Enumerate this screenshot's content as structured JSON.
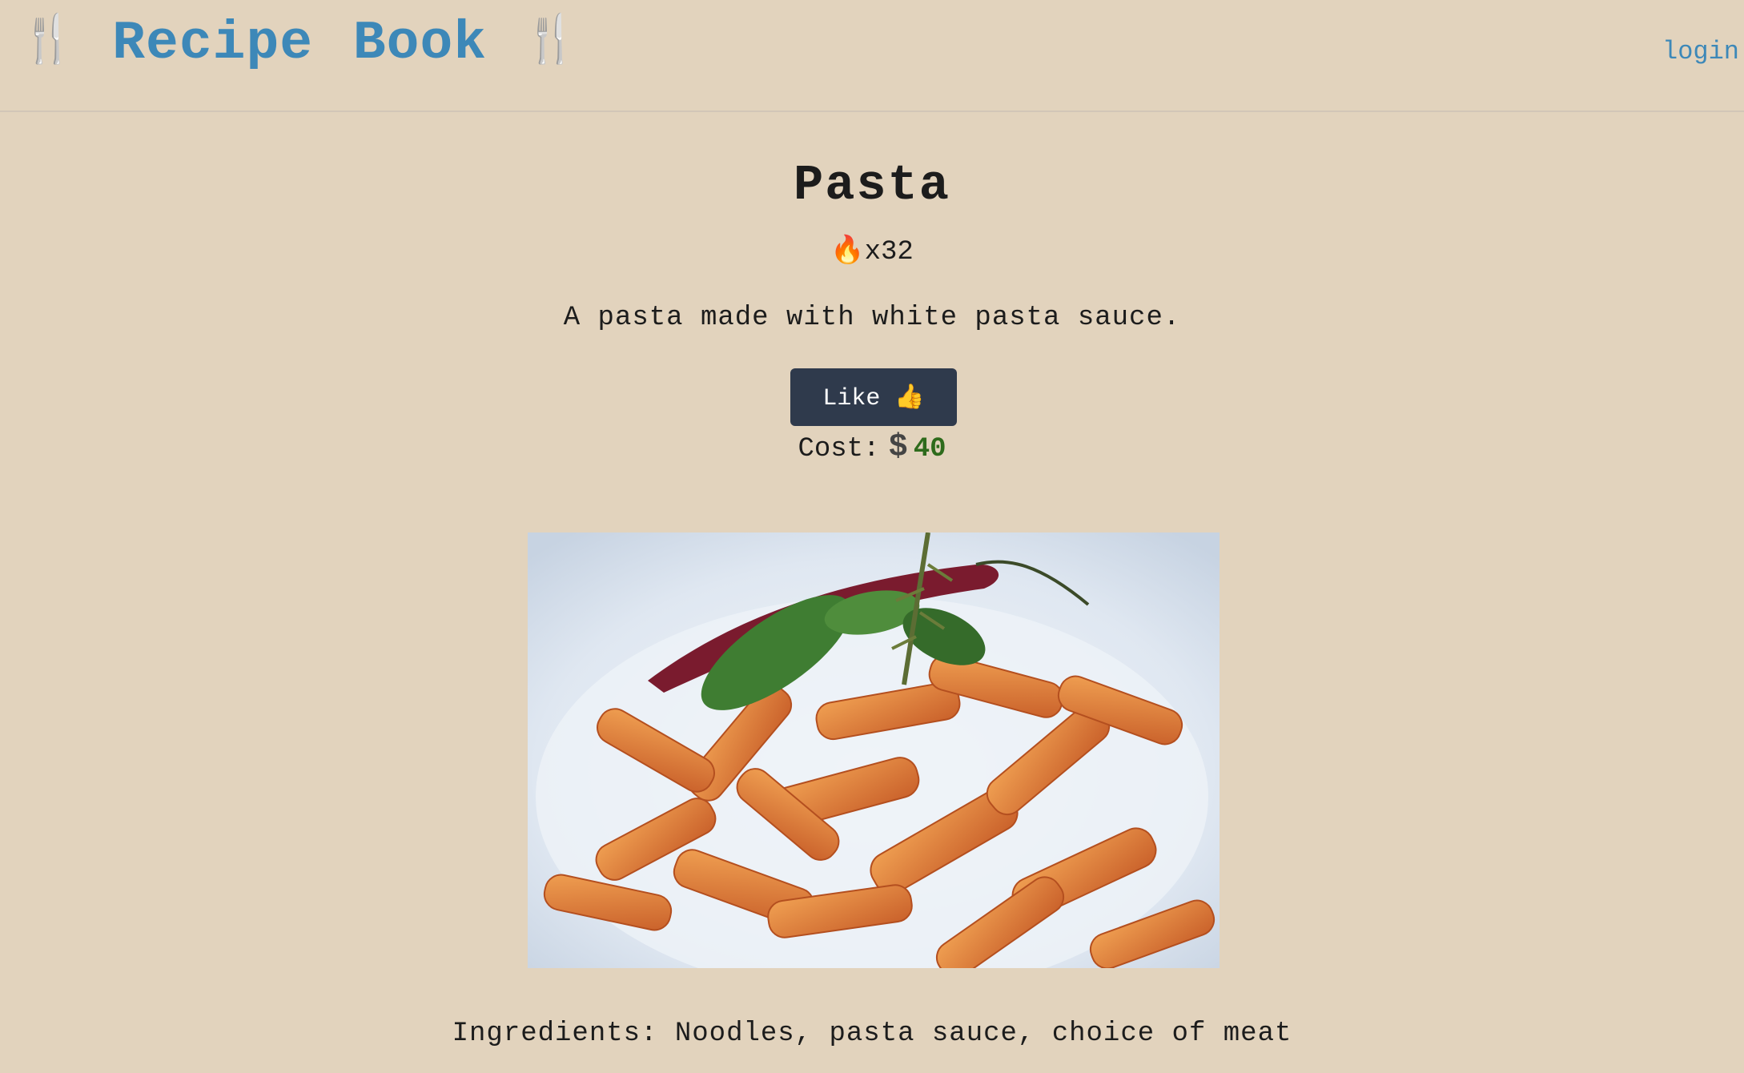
{
  "header": {
    "brand_icon_left": "🍴",
    "brand_title": "Recipe Book",
    "brand_icon_right": "🍴",
    "login_label": "login"
  },
  "recipe": {
    "title": "Pasta",
    "flame_icon": "🔥",
    "likes_text": "x32",
    "description": "A pasta made with white pasta sauce.",
    "like_button_label": "Like 👍",
    "cost_label": "Cost:",
    "cost_symbol": "$",
    "cost_value": "40",
    "ingredients_text": "Ingredients: Noodles, pasta sauce, choice of meat"
  },
  "icons": {
    "brand": "fork-knife-icon",
    "likes": "fire-icon",
    "like_button": "thumbs-up-icon",
    "cost": "dollar-icon"
  },
  "colors": {
    "background": "#e2d3bd",
    "brand": "#3d88b8",
    "button_bg": "#2f3a4c",
    "cost_value": "#2e6b1c"
  }
}
